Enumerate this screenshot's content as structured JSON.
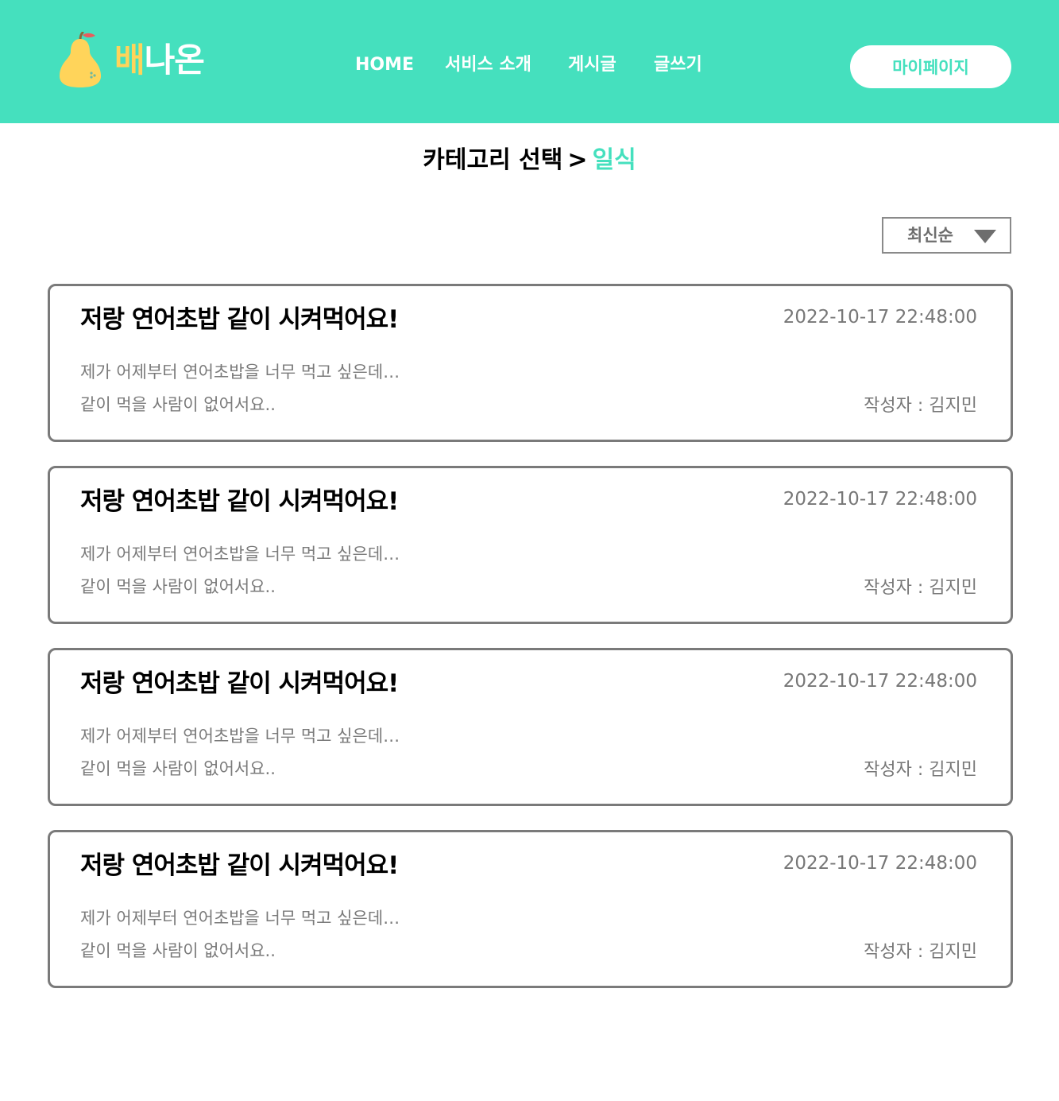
{
  "header": {
    "logo": {
      "text_part1": "배",
      "text_part2": "나온",
      "icon": "pear-icon",
      "colors": {
        "accent": "#FFD45A",
        "text": "#ffffff"
      }
    },
    "nav": [
      {
        "label": "HOME"
      },
      {
        "label": "서비스 소개"
      },
      {
        "label": "게시글"
      },
      {
        "label": "글쓰기"
      }
    ],
    "mypage_label": "마이페이지",
    "background": "#45E0BE"
  },
  "breadcrumb": {
    "root": "카테고리 선택",
    "separator": ">",
    "current": "일식"
  },
  "sort": {
    "selected": "최신순",
    "icon": "caret-down-icon"
  },
  "posts": [
    {
      "title": "저랑 연어초밥 같이 시켜먹어요!",
      "date": "2022-10-17 22:48:00",
      "excerpt_line1": "제가 어제부터 연어초밥을 너무 먹고 싶은데…",
      "excerpt_line2": "같이 먹을 사람이 없어서요..",
      "author": "작성자 : 김지민"
    },
    {
      "title": "저랑 연어초밥 같이 시켜먹어요!",
      "date": "2022-10-17 22:48:00",
      "excerpt_line1": "제가 어제부터 연어초밥을 너무 먹고 싶은데…",
      "excerpt_line2": "같이 먹을 사람이 없어서요..",
      "author": "작성자 : 김지민"
    },
    {
      "title": "저랑 연어초밥 같이 시켜먹어요!",
      "date": "2022-10-17 22:48:00",
      "excerpt_line1": "제가 어제부터 연어초밥을 너무 먹고 싶은데…",
      "excerpt_line2": "같이 먹을 사람이 없어서요..",
      "author": "작성자 : 김지민"
    },
    {
      "title": "저랑 연어초밥 같이 시켜먹어요!",
      "date": "2022-10-17 22:48:00",
      "excerpt_line1": "제가 어제부터 연어초밥을 너무 먹고 싶은데…",
      "excerpt_line2": "같이 먹을 사람이 없어서요..",
      "author": "작성자 : 김지민"
    }
  ]
}
